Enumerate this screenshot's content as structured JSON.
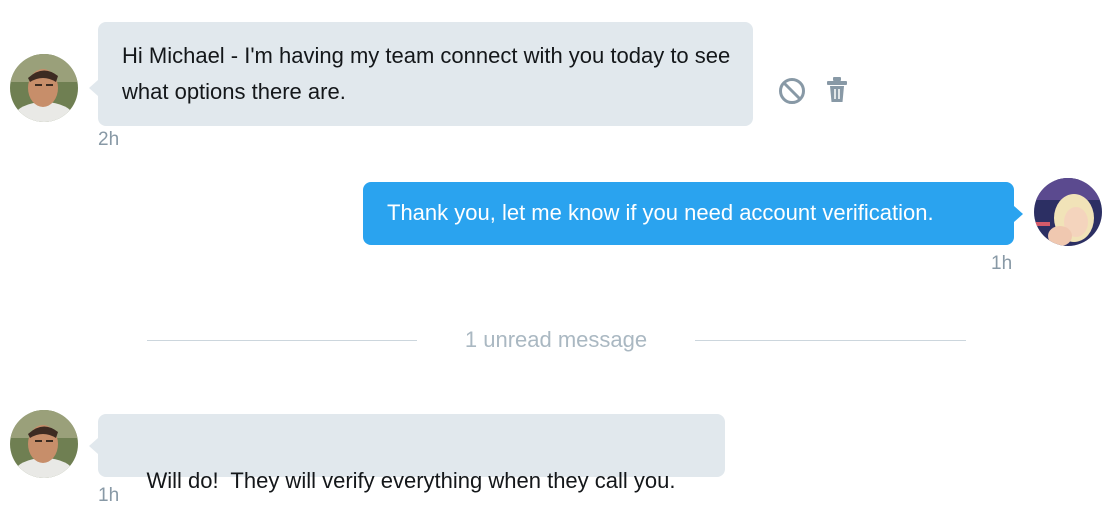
{
  "messages": [
    {
      "direction": "received",
      "text": "Hi Michael - I'm having my team connect with you today to see what options there are.",
      "timestamp": "2h",
      "actions": [
        "block-icon",
        "trash-icon"
      ]
    },
    {
      "direction": "sent",
      "text": "Thank you, let me know if you need account verification.",
      "timestamp": "1h"
    },
    {
      "direction": "received",
      "text": "Will do!  They will verify everything when they call you.",
      "timestamp": "1h"
    }
  ],
  "unread_divider": {
    "text": "1 unread message"
  },
  "colors": {
    "received_bubble": "#e1e8ed",
    "sent_bubble": "#2aa3ef",
    "timestamp": "#8899a6",
    "divider_line": "#ccd6dd",
    "divider_text": "#aab8c2"
  }
}
